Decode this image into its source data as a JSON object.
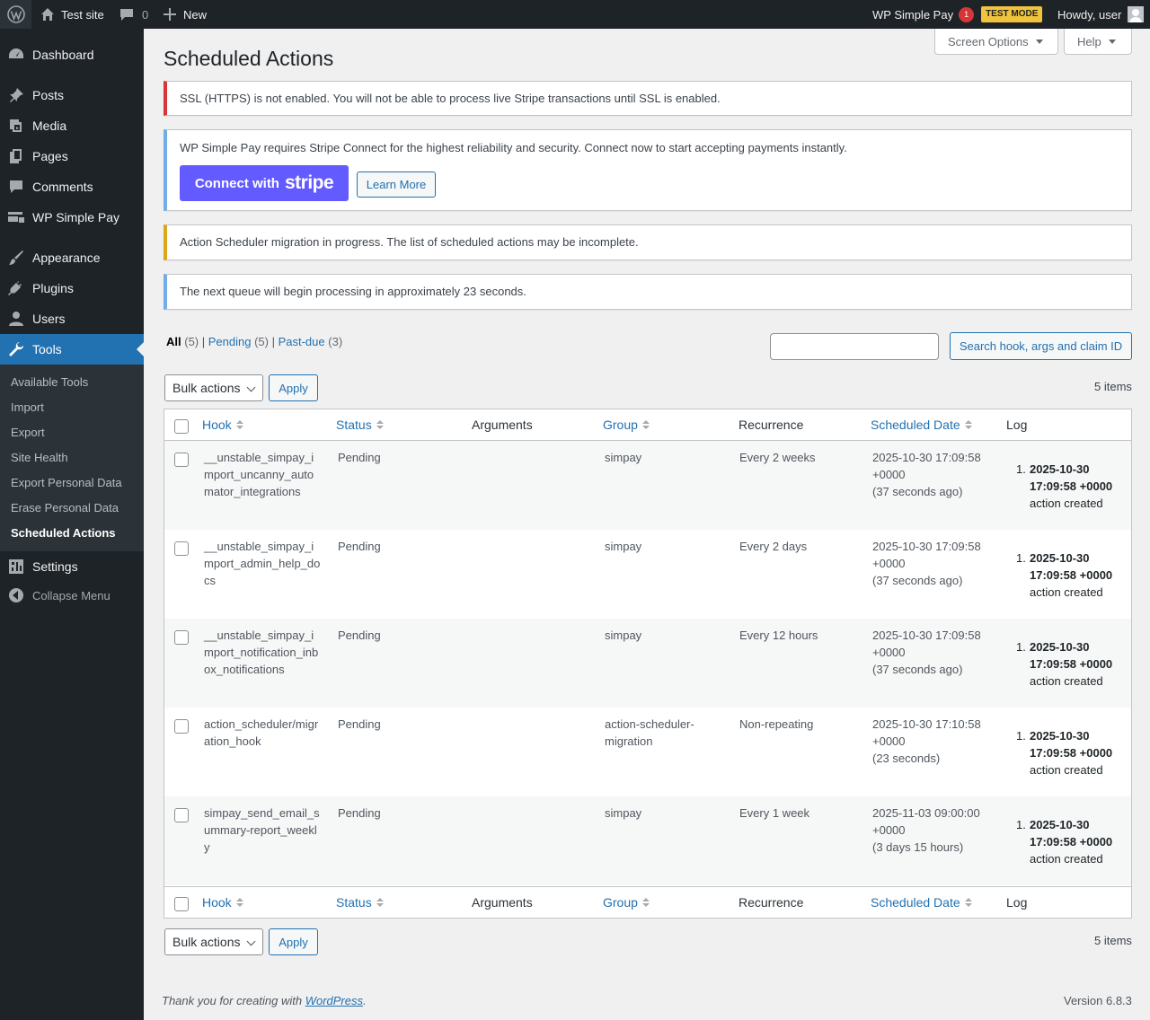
{
  "admin_bar": {
    "site_name": "Test site",
    "comments_count": "0",
    "new_label": "New",
    "simpay_label": "WP Simple Pay",
    "notification_count": "1",
    "test_mode": "TEST MODE",
    "howdy": "Howdy, user"
  },
  "sidebar": {
    "items": [
      {
        "label": "Dashboard",
        "icon": "dashboard-icon"
      },
      {
        "label": "Posts",
        "icon": "pin-icon"
      },
      {
        "label": "Media",
        "icon": "media-icon"
      },
      {
        "label": "Pages",
        "icon": "pages-icon"
      },
      {
        "label": "Comments",
        "icon": "comment-icon"
      },
      {
        "label": "WP Simple Pay",
        "icon": "card-icon"
      },
      {
        "label": "Appearance",
        "icon": "brush-icon"
      },
      {
        "label": "Plugins",
        "icon": "plug-icon"
      },
      {
        "label": "Users",
        "icon": "user-icon"
      },
      {
        "label": "Tools",
        "icon": "wrench-icon"
      },
      {
        "label": "Settings",
        "icon": "settings-icon"
      }
    ],
    "submenu": [
      "Available Tools",
      "Import",
      "Export",
      "Site Health",
      "Export Personal Data",
      "Erase Personal Data",
      "Scheduled Actions"
    ],
    "collapse_label": "Collapse Menu"
  },
  "screen_options": "Screen Options",
  "help": "Help",
  "page_title": "Scheduled Actions",
  "notices": {
    "ssl": "SSL (HTTPS) is not enabled. You will not be able to process live Stripe transactions until SSL is enabled.",
    "stripe": "WP Simple Pay requires Stripe Connect for the highest reliability and security. Connect now to start accepting payments instantly.",
    "stripe_button": "Connect with",
    "stripe_logo": "stripe",
    "learn_more": "Learn More",
    "migration": "Action Scheduler migration in progress. The list of scheduled actions may be incomplete.",
    "queue": "The next queue will begin processing in approximately 23 seconds."
  },
  "views": {
    "all": "All",
    "all_count": "(5)",
    "pending": "Pending",
    "pending_count": "(5)",
    "pastdue": "Past-due",
    "pastdue_count": "(3)"
  },
  "search": {
    "placeholder": "",
    "button": "Search hook, args and claim ID"
  },
  "bulk": {
    "label": "Bulk actions",
    "apply": "Apply",
    "items": "5 items"
  },
  "columns": {
    "hook": "Hook",
    "status": "Status",
    "arguments": "Arguments",
    "group": "Group",
    "recurrence": "Recurrence",
    "date": "Scheduled Date",
    "log": "Log"
  },
  "rows": [
    {
      "hook": "__unstable_simpay_import_uncanny_automator_integrations",
      "status": "Pending",
      "args": "",
      "group": "simpay",
      "recurrence": "Every 2 weeks",
      "date": "2025-10-30 17:09:58",
      "tz": "+0000",
      "rel": "(37 seconds ago)",
      "log_date": "2025-10-30",
      "log_time": "17:09:58 +0000",
      "log_msg": "action created"
    },
    {
      "hook": "__unstable_simpay_import_admin_help_docs",
      "status": "Pending",
      "args": "",
      "group": "simpay",
      "recurrence": "Every 2 days",
      "date": "2025-10-30 17:09:58",
      "tz": "+0000",
      "rel": "(37 seconds ago)",
      "log_date": "2025-10-30",
      "log_time": "17:09:58 +0000",
      "log_msg": "action created"
    },
    {
      "hook": "__unstable_simpay_import_notification_inbox_notifications",
      "status": "Pending",
      "args": "",
      "group": "simpay",
      "recurrence": "Every 12 hours",
      "date": "2025-10-30 17:09:58",
      "tz": "+0000",
      "rel": "(37 seconds ago)",
      "log_date": "2025-10-30",
      "log_time": "17:09:58 +0000",
      "log_msg": "action created"
    },
    {
      "hook": "action_scheduler/migration_hook",
      "status": "Pending",
      "args": "",
      "group": "action-scheduler-migration",
      "recurrence": "Non-repeating",
      "date": "2025-10-30 17:10:58",
      "tz": "+0000",
      "rel": "(23 seconds)",
      "log_date": "2025-10-30",
      "log_time": "17:09:58 +0000",
      "log_msg": "action created"
    },
    {
      "hook": "simpay_send_email_summary-report_weekly",
      "status": "Pending",
      "args": "",
      "group": "simpay",
      "recurrence": "Every 1 week",
      "date": "2025-11-03 09:00:00",
      "tz": "+0000",
      "rel": "(3 days 15 hours)",
      "log_date": "2025-10-30",
      "log_time": "17:09:58 +0000",
      "log_msg": "action created"
    }
  ],
  "footer": {
    "thanks_prefix": "Thank you for creating with ",
    "wordpress": "WordPress",
    "thanks_suffix": ".",
    "version": "Version 6.8.3"
  }
}
